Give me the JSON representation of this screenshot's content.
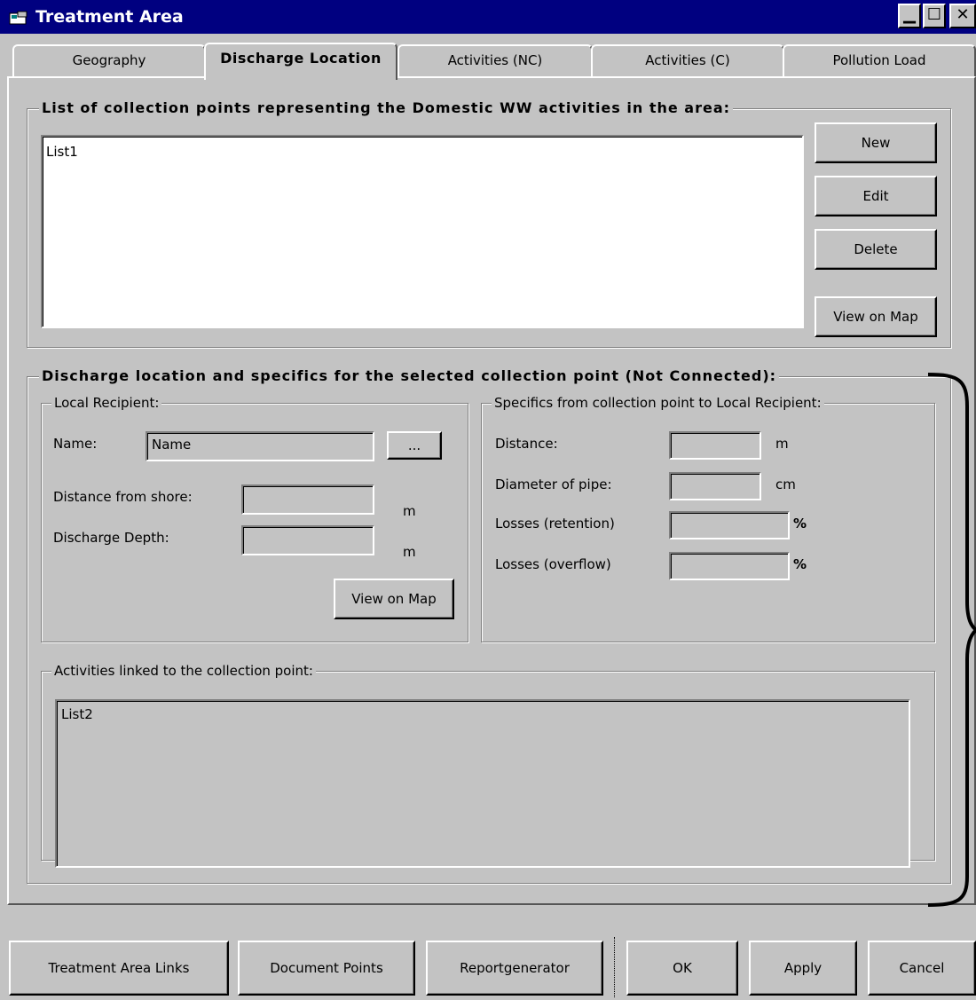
{
  "window": {
    "title": "Treatment Area"
  },
  "tabs": [
    {
      "label": "Geography"
    },
    {
      "label": "Discharge Location"
    },
    {
      "label": "Activities (NC)"
    },
    {
      "label": "Activities (C)"
    },
    {
      "label": "Pollution Load"
    }
  ],
  "collection_points": {
    "legend": "List of collection points representing the Domestic WW activities in the area:",
    "list_items": [
      "List1"
    ],
    "buttons": {
      "new": "New",
      "edit": "Edit",
      "delete": "Delete",
      "view_on_map": "View on Map"
    }
  },
  "discharge": {
    "legend": "Discharge location and specifics for the selected collection point (Not Connected):",
    "local_recipient": {
      "legend": "Local Recipient:",
      "name_label": "Name:",
      "name_value": "Name",
      "browse_label": "...",
      "distance_label": "Distance from shore:",
      "distance_unit": "m",
      "depth_label": "Discharge Depth:",
      "depth_unit": "m",
      "view_on_map": "View on Map"
    },
    "specifics": {
      "legend": "Specifics from collection point to Local Recipient:",
      "distance_label": "Distance:",
      "distance_unit": "m",
      "diameter_label": "Diameter of pipe:",
      "diameter_unit": "cm",
      "retention_label": "Losses (retention)",
      "retention_unit": "%",
      "overflow_label": "Losses (overflow)",
      "overflow_unit": "%"
    },
    "activities": {
      "legend": "Activities linked to the collection point:",
      "list_items": [
        "List2"
      ]
    }
  },
  "footer": {
    "treatment_area_links": "Treatment Area Links",
    "document_points": "Document Points",
    "reportgenerator": "Reportgenerator",
    "ok": "OK",
    "apply": "Apply",
    "cancel": "Cancel"
  }
}
